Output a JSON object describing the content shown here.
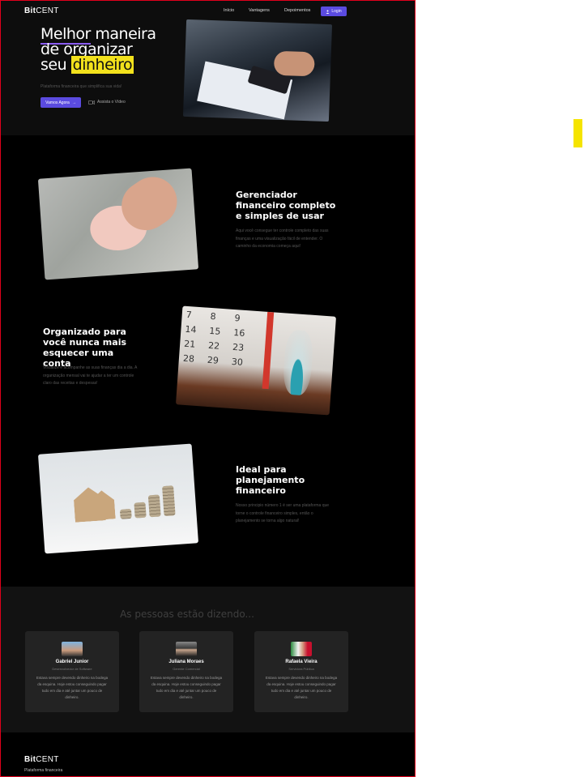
{
  "brand": {
    "logo_bold": "Bit",
    "logo_light": "CENT"
  },
  "nav": {
    "links": [
      "Início",
      "Vantagens",
      "Depoimentos"
    ],
    "login_label": "Login"
  },
  "hero": {
    "title_word1": "Melhor",
    "title_rest1": " maneira",
    "title_line2": "de organizar",
    "title_word3": "seu ",
    "title_highlight": "dinheiro",
    "subtitle": "Plataforma financeira que simplifica sua vida!",
    "cta_label": "Vamos Agora",
    "video_label": "Assista o Vídeo"
  },
  "features": [
    {
      "title": "Gerenciador financeiro completo e simples de usar",
      "text": "Aqui você consegue ter controle completo das suas finanças e uma visualização fácil de entender. O caminho da economia começa aqui!"
    },
    {
      "title": "Organizado para você nunca mais esquecer uma conta",
      "text": "Visualize e acompanhe as suas finanças dia a dia. A organização mensal vai te ajudar a ter um controle claro das receitas e despesas!"
    },
    {
      "title": "Ideal para planejamento financeiro",
      "text": "Nosso principio número 1 é ser uma plataforma que torne o controle financeiro simples, então o planejamento se torna algo natural!"
    }
  ],
  "calendar_numbers": [
    "7",
    "8",
    "9",
    "14",
    "15",
    "16",
    "21",
    "22",
    "23",
    "28",
    "29",
    "30"
  ],
  "testimonials": {
    "heading": "As pessoas estão dizendo...",
    "cards": [
      {
        "name": "Gabriel Junior",
        "role": "Desenvolvedor de Software",
        "quote": "Estava sempre devendo dinheiro na bodega da esquina. Hoje estou conseguindo pagar tudo em dia e até juntar um pouco de dinheiro."
      },
      {
        "name": "Juliana Moraes",
        "role": "Gerente Comercial",
        "quote": "Estava sempre devendo dinheiro na bodega da esquina. Hoje estou conseguindo pagar tudo em dia e até juntar um pouco de dinheiro."
      },
      {
        "name": "Rafaela Vieira",
        "role": "Servidora Pública",
        "quote": "Estava sempre devendo dinheiro na bodega da esquina. Hoje estou conseguindo pagar tudo em dia e até juntar um pouco de dinheiro."
      }
    ]
  },
  "footer": {
    "subtitle": "Plataforma financeira"
  },
  "colors": {
    "accent": "#5b4be0",
    "highlight": "#f2e11c",
    "underline": "#8a5cf0",
    "marker": "#f5e400"
  }
}
